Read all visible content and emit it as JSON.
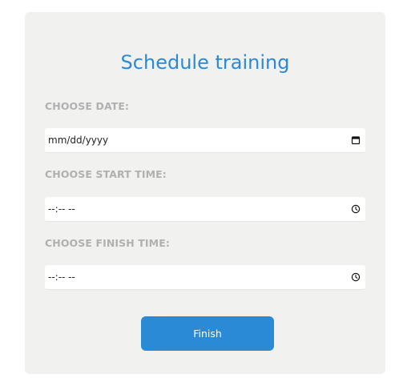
{
  "form": {
    "title": "Schedule training",
    "date": {
      "label": "CHOOSE DATE:",
      "placeholder": "mm/dd/yyyy",
      "icon": "calendar-icon"
    },
    "start_time": {
      "label": "CHOOSE START TIME:",
      "placeholder": "--:-- --",
      "icon": "clock-icon"
    },
    "finish_time": {
      "label": "CHOOSE FINISH TIME:",
      "placeholder": "--:-- --",
      "icon": "clock-icon"
    },
    "submit_label": "Finish"
  },
  "colors": {
    "accent": "#2a8ad6",
    "card_background": "#f1f1f0",
    "label": "#b0b0b0"
  }
}
